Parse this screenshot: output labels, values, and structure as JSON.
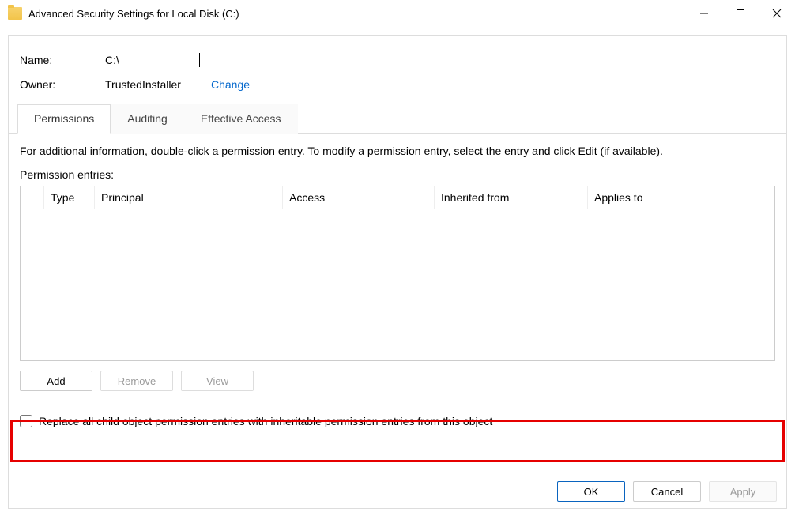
{
  "window": {
    "title": "Advanced Security Settings for Local Disk (C:)"
  },
  "name_row": {
    "label": "Name:",
    "value": "C:\\"
  },
  "owner_row": {
    "label": "Owner:",
    "value": "TrustedInstaller",
    "change": "Change"
  },
  "tabs": {
    "permissions": "Permissions",
    "auditing": "Auditing",
    "effective": "Effective Access"
  },
  "info_text": "For additional information, double-click a permission entry. To modify a permission entry, select the entry and click Edit (if available).",
  "entries_label": "Permission entries:",
  "columns": {
    "type": "Type",
    "principal": "Principal",
    "access": "Access",
    "inherited": "Inherited from",
    "applies": "Applies to"
  },
  "buttons": {
    "add": "Add",
    "remove": "Remove",
    "view": "View",
    "ok": "OK",
    "cancel": "Cancel",
    "apply": "Apply"
  },
  "checkbox_label": "Replace all child object permission entries with inheritable permission entries from this object"
}
